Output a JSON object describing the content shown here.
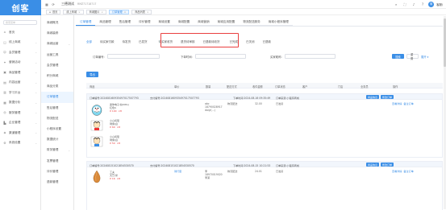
{
  "app": {
    "logo_text": "创客"
  },
  "header": {
    "title": "三德测试",
    "subtitle": "RMZ71718717",
    "right_icons": [
      "search-icon",
      "fullscreen-icon",
      "bell-icon",
      "help-icon"
    ],
    "avatar_letter": "商",
    "username": "客服/"
  },
  "tagsbar": {
    "home": "首页",
    "tags": [
      {
        "label": "线上商城",
        "closable": true
      },
      {
        "label": "商城图片",
        "closable": true
      },
      {
        "label": "订单管理",
        "closable": true,
        "active": true
      },
      {
        "label": "商品列表",
        "closable": true
      }
    ]
  },
  "side1": {
    "search_placeholder": "搜索菜单",
    "items": [
      {
        "label": "首页",
        "icon": "home-icon"
      },
      {
        "label": "线上商城",
        "icon": "shop-icon",
        "expandable": true
      },
      {
        "label": "会员管理",
        "icon": "user-icon",
        "expandable": true
      },
      {
        "label": "营销活动",
        "icon": "gift-icon",
        "expandable": true
      },
      {
        "label": "商品管理",
        "icon": "box-icon",
        "expandable": true
      },
      {
        "label": "内容运营",
        "icon": "doc-icon",
        "expandable": true
      },
      {
        "label": "学习平台",
        "icon": "book-icon",
        "expandable": true
      },
      {
        "label": "数据分析",
        "icon": "chart-icon",
        "expandable": true
      },
      {
        "label": "服务管理",
        "icon": "service-icon",
        "expandable": true
      },
      {
        "label": "企业管理",
        "icon": "building-icon",
        "expandable": true
      },
      {
        "label": "渠道管理",
        "icon": "channel-icon",
        "expandable": true
      },
      {
        "label": "系统设置",
        "icon": "gear-icon",
        "expandable": true
      }
    ]
  },
  "side2": {
    "items": [
      {
        "label": "商城概况"
      },
      {
        "label": "商城装修"
      },
      {
        "label": "商城运营",
        "expandable": true
      },
      {
        "label": "运营工具"
      },
      {
        "label": "会员管理"
      },
      {
        "label": "积分商城"
      },
      {
        "label": "商品分类"
      },
      {
        "label": "订单管理",
        "active": true
      },
      {
        "label": "售后管理"
      },
      {
        "label": "物流配送"
      },
      {
        "label": "小程序设置"
      },
      {
        "label": "数据统计"
      },
      {
        "label": "财务管理",
        "expandable": true
      },
      {
        "label": "发票管理"
      },
      {
        "label": "评价管理"
      },
      {
        "label": "退款管理"
      }
    ]
  },
  "tabs1": [
    "订单管理",
    "商品管理",
    "售后管理",
    "评价管理",
    "商城设置",
    "商城配置",
    "商城营销",
    "商城应用配置",
    "物流配送服务",
    "商城小程序管理"
  ],
  "tabs2": [
    "全部",
    "待买家付款",
    "待发货",
    "已发货",
    "待买家收货",
    "退货待审核",
    "已退款待收货",
    "已完成",
    "已关闭",
    "已退款"
  ],
  "filters": {
    "order_no_label": "订单编号:",
    "time_label": "下单时间:",
    "buyer_label": "买家昵称:",
    "search_btn": "搜索",
    "reset_btn": "重置",
    "expand_btn": "展开 ▾"
  },
  "export_btn": "导出",
  "table_headers": [
    "商品",
    "单价",
    "数量",
    "配送方式",
    "收件金额",
    "订单状态",
    "客户",
    "门店",
    "业务员",
    "操作"
  ],
  "orders": [
    {
      "order_no": "订单编号:202408160935497017507793",
      "pay_no": "支付编号:202408160935497017507793",
      "time": "下单时间:2024-08-16 09:35:49",
      "source": "订单来源:小程序商城",
      "items": [
        {
          "name": "迷你电子书(DPG)",
          "spec": "红色S",
          "price": "¥ 100  ×8"
        },
        {
          "name": "小心机型",
          "spec": "骑乘/白",
          "price": "¥ 60  ×8"
        },
        {
          "name": "小心机型",
          "spec": "骑乘/白",
          "price": "¥ 50  ×8"
        }
      ],
      "buyer": "abc\n18790028917\ndaiyi(...)",
      "delivery": "物流配送",
      "amount": "32.00",
      "status": "已发货",
      "actions": [
        "商品信息",
        "修改订单"
      ],
      "links": "查看详情  备注订单"
    },
    {
      "order_no": "订单编号:202408151021854530570",
      "pay_no": "支付编号:202408151021854530570",
      "time": "下单时间:2024-08-15 10:21:53",
      "source": "订单来源:小程序商城",
      "items": [
        {
          "name": "工夫",
          "spec": "天竺/米",
          "price": "¥ 16  ×8"
        }
      ],
      "unit_tag": "骑行套",
      "buyer": "李\n18970019020\n李某",
      "delivery": "物流配送",
      "amount": "24.01",
      "status": "已发货",
      "actions": [
        "商品信息",
        "修改订单"
      ],
      "links": "查看详情  备注订单"
    }
  ],
  "colors": {
    "primary": "#3a8ee6",
    "highlight_border": "#e94040",
    "logo_bg": "#3a8ee6"
  }
}
